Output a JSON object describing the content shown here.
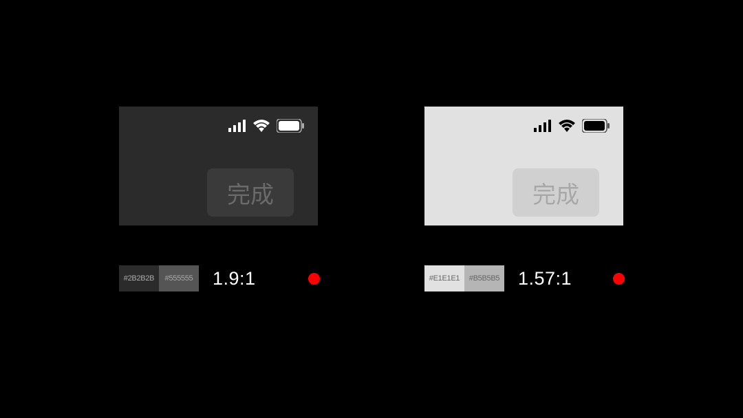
{
  "dark_panel": {
    "background": "#2B2B2B",
    "button_label": "完成",
    "swatch1": "#2B2B2B",
    "swatch2": "#555555",
    "ratio": "1.9:1",
    "status_fail": true
  },
  "light_panel": {
    "background": "#E1E1E1",
    "button_label": "完成",
    "swatch1": "#E1E1E1",
    "swatch2": "#B5B5B5",
    "ratio": "1.57:1",
    "status_fail": true
  },
  "icons": {
    "signal": "signal-icon",
    "wifi": "wifi-icon",
    "battery": "battery-icon"
  }
}
